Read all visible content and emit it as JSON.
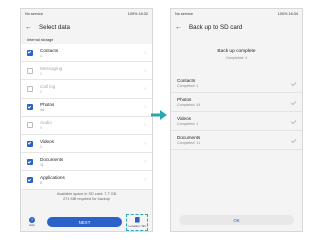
{
  "colors": {
    "accent": "#2a62c9",
    "highlight": "#2aa7b5",
    "arrow": "#2aa7b5"
  },
  "left": {
    "status": {
      "carrier": "No service",
      "right": "100% 16:32"
    },
    "title": "Select data",
    "section_label": "Internal storage",
    "items": [
      {
        "title": "Contacts",
        "sub": "1",
        "checked": true,
        "enabled": true
      },
      {
        "title": "Messaging",
        "sub": "0",
        "checked": false,
        "enabled": false
      },
      {
        "title": "Call log",
        "sub": "0",
        "checked": false,
        "enabled": false
      },
      {
        "title": "Photos",
        "sub": "44",
        "checked": true,
        "enabled": true
      },
      {
        "title": "Audio",
        "sub": "0",
        "checked": false,
        "enabled": false
      },
      {
        "title": "Videos",
        "sub": "1",
        "checked": true,
        "enabled": true
      },
      {
        "title": "Documents",
        "sub": "11",
        "checked": true,
        "enabled": true
      },
      {
        "title": "Applications",
        "sub": "0",
        "checked": true,
        "enabled": true
      }
    ],
    "space_line1": "Available space in SD card: 7.7 GB",
    "space_line2": "271 MB required for backup",
    "help_label": "Help",
    "next_label": "NEXT",
    "sdcard_label": "Location: SD"
  },
  "right": {
    "status": {
      "carrier": "No service",
      "right": "100% 16:34"
    },
    "title": "Back up to SD card",
    "complete_title": "Back up complete",
    "complete_sub": "Completed: 4",
    "items": [
      {
        "title": "Contacts",
        "sub": "Completed: 1"
      },
      {
        "title": "Photos",
        "sub": "Completed: 44"
      },
      {
        "title": "Videos",
        "sub": "Completed: 1"
      },
      {
        "title": "Documents",
        "sub": "Completed: 11"
      }
    ],
    "ok_label": "OK"
  }
}
